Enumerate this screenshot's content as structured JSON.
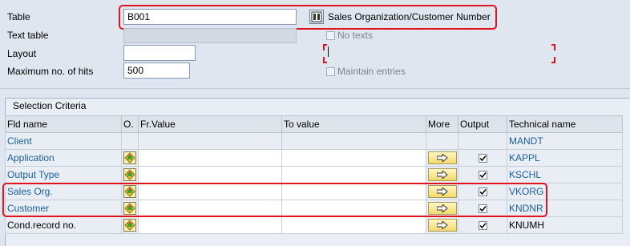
{
  "form": {
    "table_label": "Table",
    "table_value": "B001",
    "table_description": "Sales Organization/Customer Number",
    "text_table_label": "Text table",
    "text_table_value": "",
    "layout_label": "Layout",
    "layout_value": "",
    "max_hits_label": "Maximum no. of hits",
    "max_hits_value": "500",
    "no_texts_label": "No texts",
    "maintain_entries_label": "Maintain entries"
  },
  "selection": {
    "title": "Selection Criteria",
    "columns": {
      "fld_name": "Fld name",
      "o": "O.",
      "fr_value": "Fr.Value",
      "to_value": "To value",
      "more": "More",
      "output": "Output",
      "technical_name": "Technical name"
    },
    "rows": [
      {
        "field": "Client",
        "tech": "MANDT",
        "has_select": false,
        "has_more": false,
        "has_output": false,
        "editable": false
      },
      {
        "field": "Application",
        "tech": "KAPPL",
        "has_select": true,
        "has_more": true,
        "has_output": true,
        "output_checked": true,
        "editable": true
      },
      {
        "field": "Output Type",
        "tech": "KSCHL",
        "has_select": true,
        "has_more": true,
        "has_output": true,
        "output_checked": true,
        "editable": true
      },
      {
        "field": "Sales Org.",
        "tech": "VKORG",
        "has_select": true,
        "has_more": true,
        "has_output": true,
        "output_checked": true,
        "editable": true
      },
      {
        "field": "Customer",
        "tech": "KNDNR",
        "has_select": true,
        "has_more": true,
        "has_output": true,
        "output_checked": true,
        "editable": true
      },
      {
        "field": "Cond.record no.",
        "tech": "KNUMH",
        "has_select": true,
        "has_more": true,
        "has_output": true,
        "output_checked": true,
        "editable": true
      }
    ]
  },
  "colors": {
    "highlight": "#e0141e",
    "link_blue": "#1a5f9e",
    "background": "#dfe6ef"
  }
}
